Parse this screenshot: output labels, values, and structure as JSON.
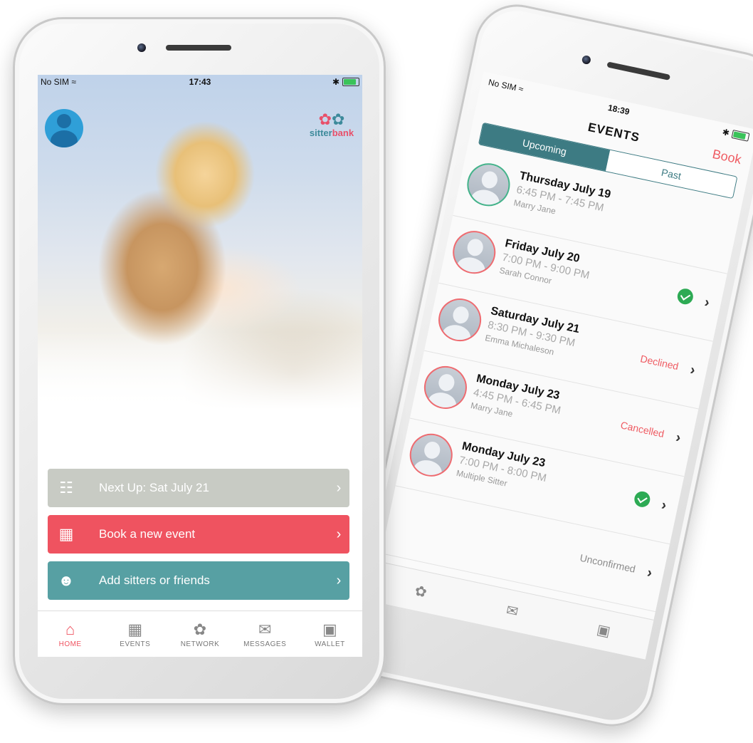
{
  "right_phone": {
    "status": {
      "carrier": "No SIM",
      "time": "18:39"
    },
    "header": {
      "title": "EVENTS",
      "book_label": "Book"
    },
    "segments": {
      "upcoming": "Upcoming",
      "past": "Past"
    },
    "events": [
      {
        "date": "Thursday July 19",
        "time": "6:45 PM - 7:45 PM",
        "sitter": "Marry Jane",
        "status": "",
        "confirmed": false,
        "avatar_color": "green"
      },
      {
        "date": "Friday July 20",
        "time": "7:00 PM - 9:00 PM",
        "sitter": "Sarah Connor",
        "status": "",
        "confirmed": true,
        "avatar_color": "red"
      },
      {
        "date": "Saturday July 21",
        "time": "8:30 PM - 9:30 PM",
        "sitter": "Emma Michaleson",
        "status": "Declined",
        "confirmed": false,
        "avatar_color": "red"
      },
      {
        "date": "Monday July 23",
        "time": "4:45 PM - 6:45 PM",
        "sitter": "Marry Jane",
        "status": "Cancelled",
        "confirmed": false,
        "avatar_color": "red"
      },
      {
        "date": "Monday July 23",
        "time": "7:00 PM - 8:00 PM",
        "sitter": "Multiple Sitter",
        "status": "",
        "confirmed": true,
        "avatar_color": "red"
      },
      {
        "date": "",
        "time": "",
        "sitter": "",
        "status": "Unconfirmed",
        "confirmed": false,
        "avatar_color": "none"
      }
    ]
  },
  "left_phone": {
    "status": {
      "carrier": "No SIM",
      "time": "17:43"
    },
    "logo": {
      "word_a": "sitter",
      "word_b": "bank"
    },
    "actions": {
      "next_up": "Next Up: Sat July 21",
      "book_new": "Book a new event",
      "add_sitters": "Add sitters or friends"
    },
    "tabs": {
      "home": "HOME",
      "events": "EVENTS",
      "network": "NETWORK",
      "messages": "MESSAGES",
      "wallet": "WALLET"
    }
  },
  "colors": {
    "accent_red": "#ef5360",
    "accent_teal": "#3d7b83",
    "confirmed_green": "#2daa54",
    "next_up_gray": "#c8cbc4"
  }
}
